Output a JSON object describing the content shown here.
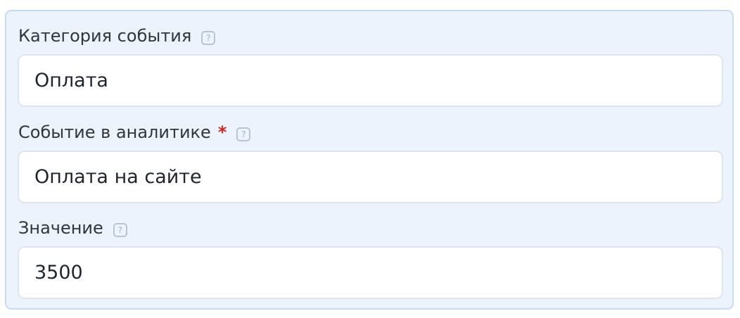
{
  "form": {
    "fields": [
      {
        "label": "Категория события",
        "required": false,
        "help_icon": "?",
        "value": "Оплата"
      },
      {
        "label": "Событие в аналитике",
        "required": true,
        "required_mark": "*",
        "help_icon": "?",
        "value": "Оплата на сайте"
      },
      {
        "label": "Значение",
        "required": false,
        "help_icon": "?",
        "value": "3500"
      }
    ]
  },
  "colors": {
    "panel_background": "#edf3fd",
    "panel_border": "#c9daf2",
    "required_star": "#d8231f",
    "label_text": "#2f3640",
    "input_border": "#dfe5ee"
  }
}
